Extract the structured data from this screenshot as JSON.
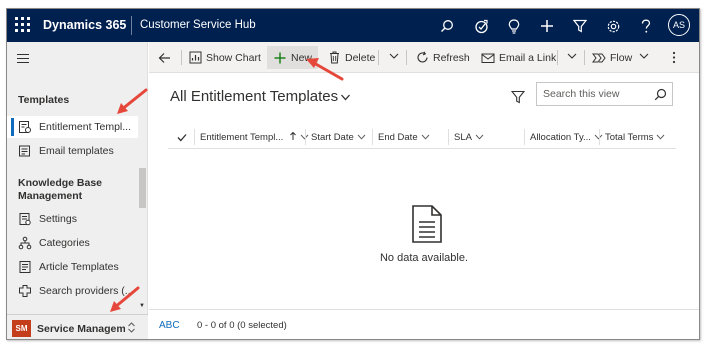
{
  "topbar": {
    "brand": "Dynamics 365",
    "app_name": "Customer Service Hub",
    "avatar_initials": "AS",
    "icons": [
      "search-icon",
      "assistant-icon",
      "lightbulb-icon",
      "plus-icon",
      "filter-icon",
      "gear-icon",
      "help-icon"
    ]
  },
  "sidebar": {
    "sections": [
      {
        "title": "Templates"
      },
      {
        "title": "Knowledge Base Management"
      }
    ],
    "templates_items": [
      {
        "label": "Entitlement Templ...",
        "icon": "entitlement-template-icon",
        "active": true
      },
      {
        "label": "Email templates",
        "icon": "email-template-icon",
        "active": false
      }
    ],
    "kb_items": [
      {
        "label": "Settings",
        "icon": "settings-icon"
      },
      {
        "label": "Categories",
        "icon": "categories-icon"
      },
      {
        "label": "Article Templates",
        "icon": "article-template-icon"
      },
      {
        "label": "Search providers (...",
        "icon": "search-providers-icon"
      }
    ],
    "area": {
      "badge": "SM",
      "label": "Service Managem..."
    }
  },
  "commandbar": {
    "show_chart": "Show Chart",
    "new": "New",
    "delete": "Delete",
    "refresh": "Refresh",
    "email_link": "Email a Link",
    "flow": "Flow"
  },
  "view": {
    "title": "All Entitlement Templates",
    "search_placeholder": "Search this view",
    "columns": [
      "Entitlement Templ...",
      "Start Date",
      "End Date",
      "SLA",
      "Allocation Ty...",
      "Total Terms"
    ],
    "empty_text": "No data available."
  },
  "footer": {
    "abc": "ABC",
    "count": "0 - 0 of 0 (0 selected)"
  },
  "colors": {
    "topbar_bg": "#002050",
    "accent": "#0f6cbd",
    "new_plus": "#107c10",
    "area_badge": "#c43e1c",
    "annotation_arrow": "#e5483a"
  }
}
